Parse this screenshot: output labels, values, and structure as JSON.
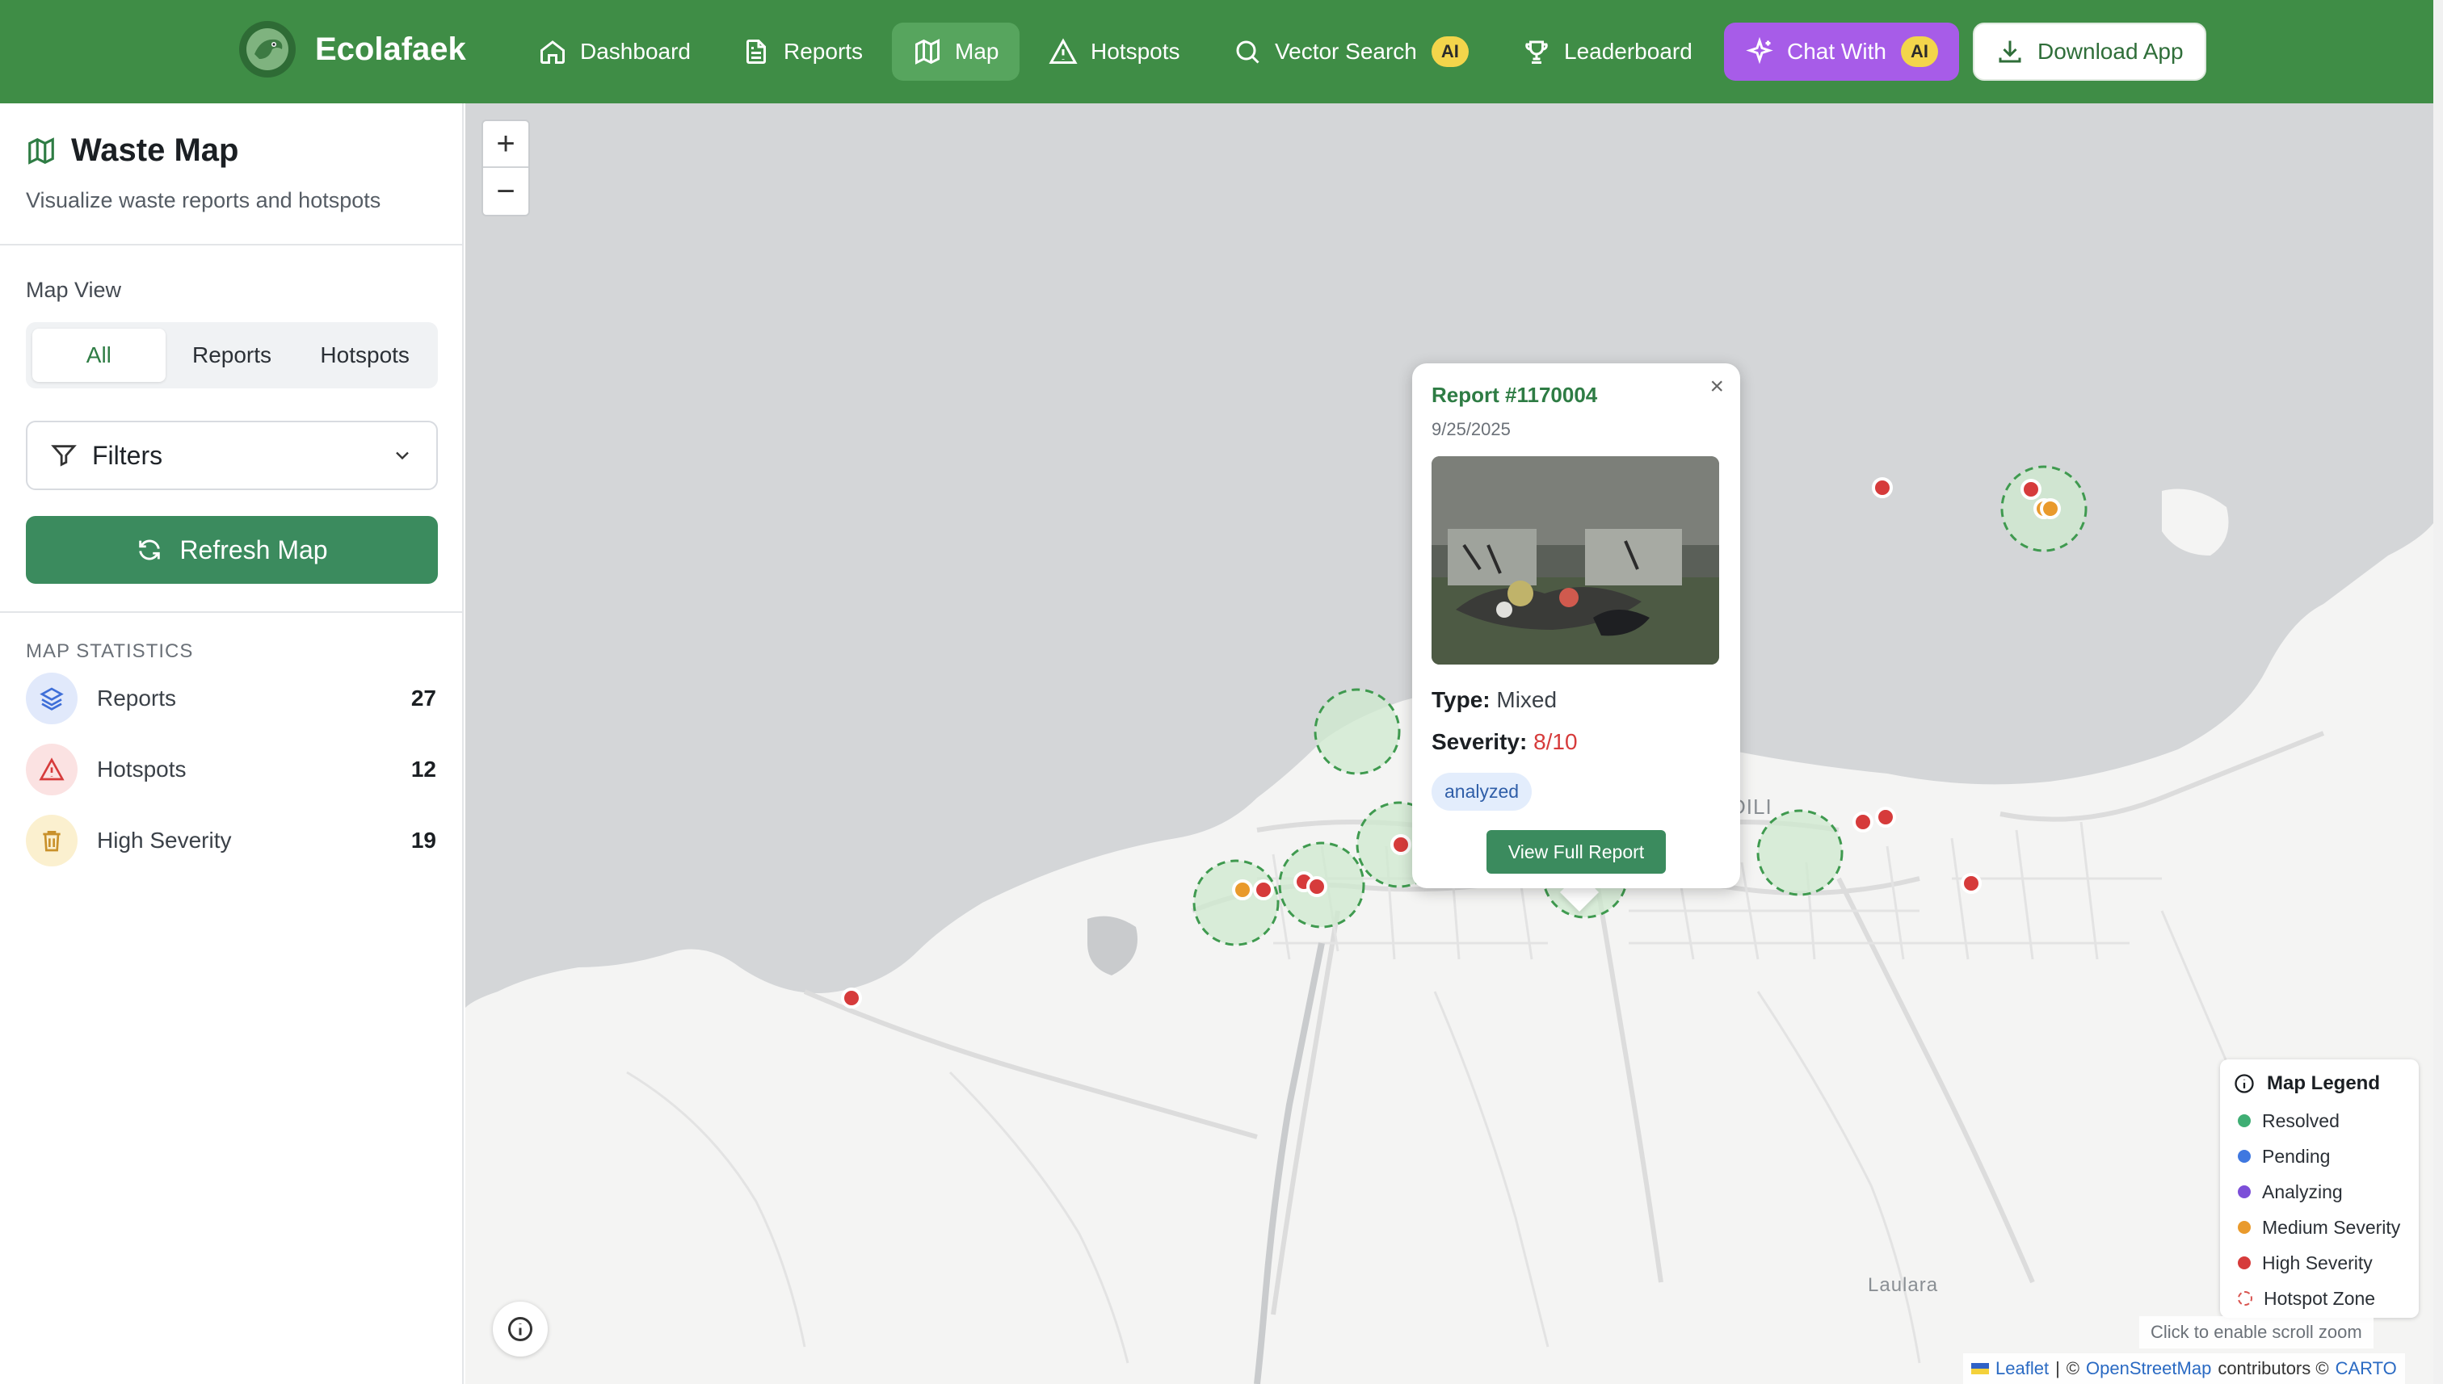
{
  "navbar": {
    "brand": "Ecolafaek",
    "items": [
      {
        "label": "Dashboard",
        "icon": "home-icon"
      },
      {
        "label": "Reports",
        "icon": "file-icon"
      },
      {
        "label": "Map",
        "icon": "map-icon",
        "active": true
      },
      {
        "label": "Hotspots",
        "icon": "warning-icon"
      },
      {
        "label": "Vector Search",
        "icon": "search-icon",
        "badge": "AI"
      },
      {
        "label": "Leaderboard",
        "icon": "trophy-icon"
      },
      {
        "label": "Chat With",
        "icon": "sparkle-icon",
        "badge": "AI"
      },
      {
        "label": "Download App",
        "icon": "download-icon"
      }
    ]
  },
  "sidebar": {
    "title": "Waste Map",
    "subtitle": "Visualize waste reports and hotspots",
    "map_view_label": "Map View",
    "view_options": [
      "All",
      "Reports",
      "Hotspots"
    ],
    "selected_view": "All",
    "filters_label": "Filters",
    "refresh_label": "Refresh Map",
    "stats_label": "MAP STATISTICS",
    "stats": [
      {
        "name": "Reports",
        "value": "27",
        "icon": "layers-icon",
        "color": "#3f6fd8"
      },
      {
        "name": "Hotspots",
        "value": "12",
        "icon": "warning-icon",
        "color": "#d63b3b"
      },
      {
        "name": "High Severity",
        "value": "19",
        "icon": "trash-icon",
        "color": "#c9912b"
      }
    ]
  },
  "map": {
    "zoom_in": "+",
    "zoom_out": "−",
    "place_labels": [
      "DILI",
      "Laulara"
    ],
    "popup": {
      "title": "Report #1170004",
      "date": "9/25/2025",
      "type_label": "Type:",
      "type_value": "Mixed",
      "severity_label": "Severity:",
      "severity_value": "8/10",
      "status": "analyzed",
      "button": "View Full Report",
      "close": "×"
    },
    "legend": {
      "title": "Map Legend",
      "items": [
        {
          "label": "Resolved",
          "color": "#3fae74"
        },
        {
          "label": "Pending",
          "color": "#3f78e0"
        },
        {
          "label": "Analyzing",
          "color": "#7c4fd8"
        },
        {
          "label": "Medium Severity",
          "color": "#e99a2c"
        },
        {
          "label": "High Severity",
          "color": "#d63b3b"
        },
        {
          "label": "Hotspot Zone",
          "color": "#d63b3b"
        }
      ]
    },
    "scroll_hint": "Click to enable scroll zoom",
    "attribution": {
      "leaflet": "Leaflet",
      "sep1": "|",
      "copy1": "©",
      "osm": "OpenStreetMap",
      "contributors": "contributors ©",
      "carto": "CARTO"
    }
  },
  "colors": {
    "nav_bg": "#3f8d46",
    "accent": "#3b8b5e",
    "chat": "#a75ce8",
    "high": "#d63b3b",
    "medium": "#e99a2c",
    "hotspot_fill": "#cfe9cf",
    "hotspot_stroke": "#3f9a4f",
    "sea": "#d4d6d8"
  }
}
